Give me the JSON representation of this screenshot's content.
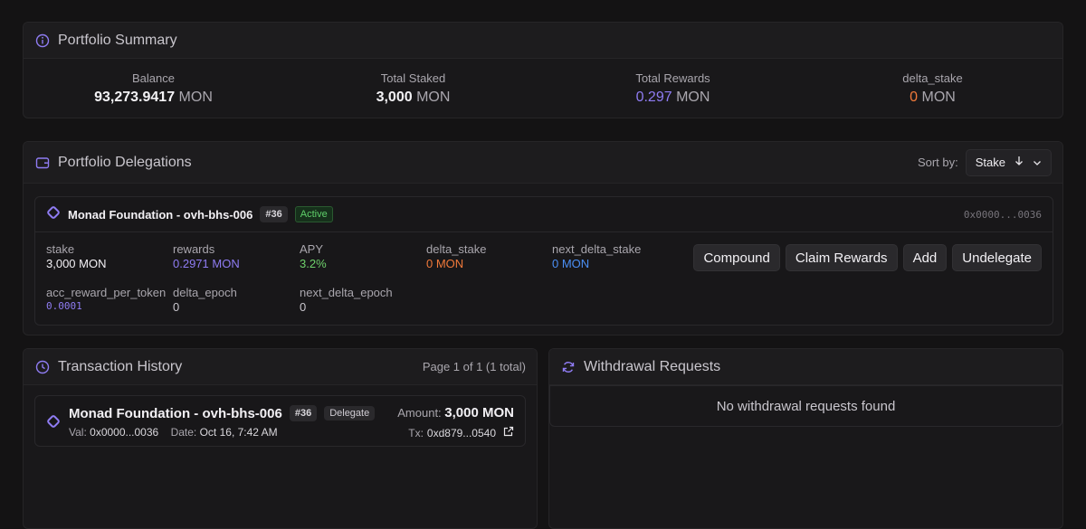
{
  "summary": {
    "title": "Portfolio Summary",
    "stats": [
      {
        "label": "Balance",
        "value": "93,273.9417",
        "unit": "MON"
      },
      {
        "label": "Total Staked",
        "value": "3,000",
        "unit": "MON"
      },
      {
        "label": "Total Rewards",
        "value": "0.297",
        "unit": "MON"
      },
      {
        "label": "delta_stake",
        "value": "0",
        "unit": "MON"
      }
    ]
  },
  "delegations": {
    "title": "Portfolio Delegations",
    "sort_label": "Sort by:",
    "sort_value": "Stake",
    "item": {
      "validator": "Monad Foundation - ovh-bhs-006",
      "rank": "#36",
      "status": "Active",
      "address": "0x0000...0036",
      "fields": {
        "stake": {
          "label": "stake",
          "value": "3,000 MON"
        },
        "rewards": {
          "label": "rewards",
          "value": "0.2971 MON"
        },
        "apy": {
          "label": "APY",
          "value": "3.2%"
        },
        "delta_stake": {
          "label": "delta_stake",
          "value": "0 MON"
        },
        "next_delta_stake": {
          "label": "next_delta_stake",
          "value": "0 MON"
        },
        "acc_reward_per_token": {
          "label": "acc_reward_per_token",
          "value": "0.0001"
        },
        "delta_epoch": {
          "label": "delta_epoch",
          "value": "0"
        },
        "next_delta_epoch": {
          "label": "next_delta_epoch",
          "value": "0"
        }
      },
      "actions": {
        "compound": "Compound",
        "claim": "Claim Rewards",
        "add": "Add",
        "undelegate": "Undelegate"
      }
    }
  },
  "history": {
    "title": "Transaction History",
    "page_info": "Page 1 of 1 (1 total)",
    "tx": {
      "validator": "Monad Foundation - ovh-bhs-006",
      "rank": "#36",
      "type": "Delegate",
      "amount_label": "Amount:",
      "amount": "3,000 MON",
      "val_label": "Val:",
      "val": "0x0000...0036",
      "date_label": "Date:",
      "date": "Oct 16, 7:42 AM",
      "tx_label": "Tx:",
      "tx_hash": "0xd879...0540"
    }
  },
  "withdrawals": {
    "title": "Withdrawal Requests",
    "empty_text": "No withdrawal requests found"
  },
  "colors": {
    "accent_purple": "#8f7cf3",
    "orange": "#f0793a",
    "green": "#6fd16c",
    "blue": "#4b8ff5"
  },
  "icons": {
    "summary": "info-icon",
    "delegations": "wallet-icon",
    "history": "clock-icon",
    "withdrawals": "refresh-icon",
    "validator": "monad-logo-icon"
  }
}
